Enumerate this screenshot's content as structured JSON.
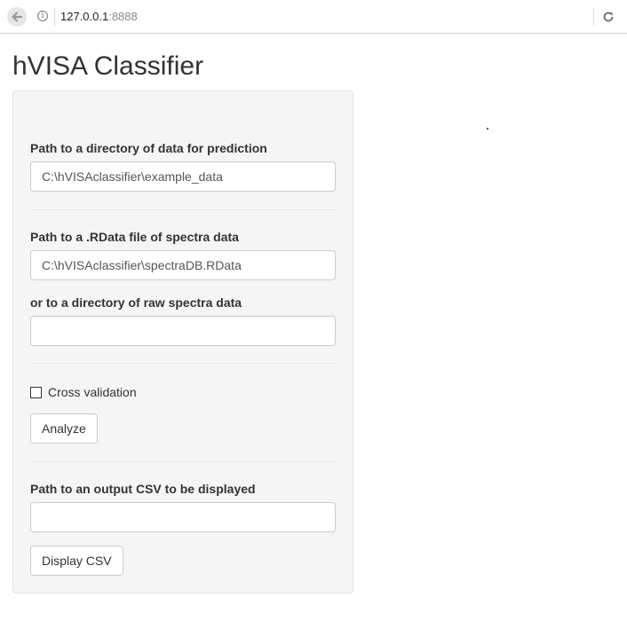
{
  "browser": {
    "url_host": "127.0.0.1",
    "url_port": ":8888",
    "icons": {
      "back": "arrow-left-icon",
      "info": "info-icon",
      "reload": "reload-icon"
    }
  },
  "page": {
    "title": "hVISA Classifier"
  },
  "form": {
    "prediction_dir": {
      "label": "Path to a directory of data for prediction",
      "value": "C:\\hVISAclassifier\\example_data"
    },
    "spectra_file": {
      "label": "Path to a .RData file of spectra data",
      "value": "C:\\hVISAclassifier\\spectraDB.RData"
    },
    "raw_spectra_dir": {
      "label": "or to a directory of raw spectra data",
      "value": ""
    },
    "cross_validation": {
      "label": "Cross validation",
      "checked": false
    },
    "analyze_button": "Analyze",
    "output_csv": {
      "label": "Path to an output CSV to be displayed",
      "value": ""
    },
    "display_csv_button": "Display CSV"
  },
  "colors": {
    "panel_bg": "#f5f5f5",
    "panel_border": "#e3e3e3",
    "text": "#333333",
    "input_border": "#cccccc"
  }
}
